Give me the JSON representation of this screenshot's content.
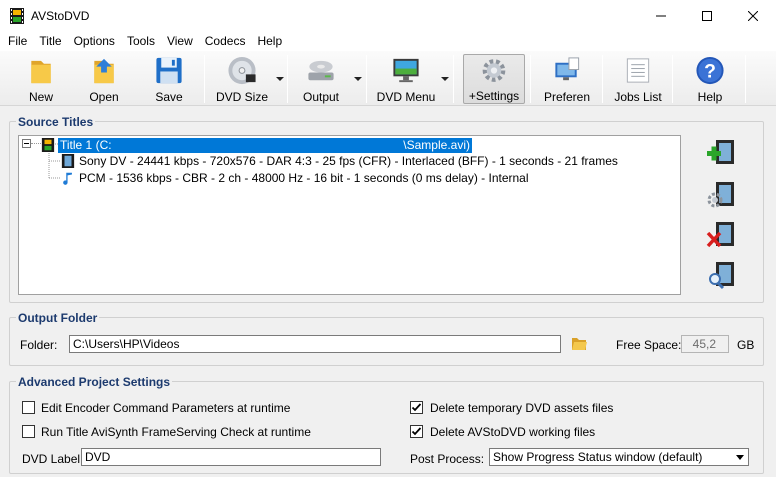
{
  "window": {
    "title": "AVStoDVD"
  },
  "menu": [
    "File",
    "Title",
    "Options",
    "Tools",
    "View",
    "Codecs",
    "Help"
  ],
  "toolbar": {
    "new": "New",
    "open": "Open",
    "save": "Save",
    "dvd_size": "DVD Size",
    "output": "Output",
    "dvd_menu": "DVD Menu",
    "settings": "+Settings",
    "preferences": "Preferen",
    "jobs_list": "Jobs List",
    "help": "Help"
  },
  "source_titles": {
    "heading": "Source Titles",
    "title_row_left": "Title 1 (C:",
    "title_row_right": "\\Sample.avi)",
    "video_row": "Sony DV - 24441 kbps - 720x576 - DAR 4:3 - 25 fps (CFR) - Interlaced (BFF) - 1 seconds - 21 frames",
    "audio_row": "PCM - 1536 kbps - CBR - 2 ch - 48000 Hz - 16 bit - 1 seconds (0 ms delay) - Internal"
  },
  "output_folder": {
    "heading": "Output Folder",
    "folder_label": "Folder:",
    "folder_value": "C:\\Users\\HP\\Videos",
    "free_space_label": "Free Space:",
    "free_space_value": "45,2",
    "free_space_unit": "GB"
  },
  "advanced": {
    "heading": "Advanced Project Settings",
    "edit_encoder": {
      "label": "Edit Encoder Command Parameters at runtime",
      "checked": false
    },
    "run_check": {
      "label": "Run Title AviSynth FrameServing Check at runtime",
      "checked": false
    },
    "delete_temp": {
      "label": "Delete temporary DVD assets files",
      "checked": true
    },
    "delete_working": {
      "label": "Delete AVStoDVD working files",
      "checked": true
    },
    "dvd_label_label": "DVD Label:",
    "dvd_label_value": "DVD",
    "post_process_label": "Post Process:",
    "post_process_value": "Show Progress Status window (default)"
  },
  "colors": {
    "selection": "#0078d7",
    "heading": "#1c3a6e"
  }
}
